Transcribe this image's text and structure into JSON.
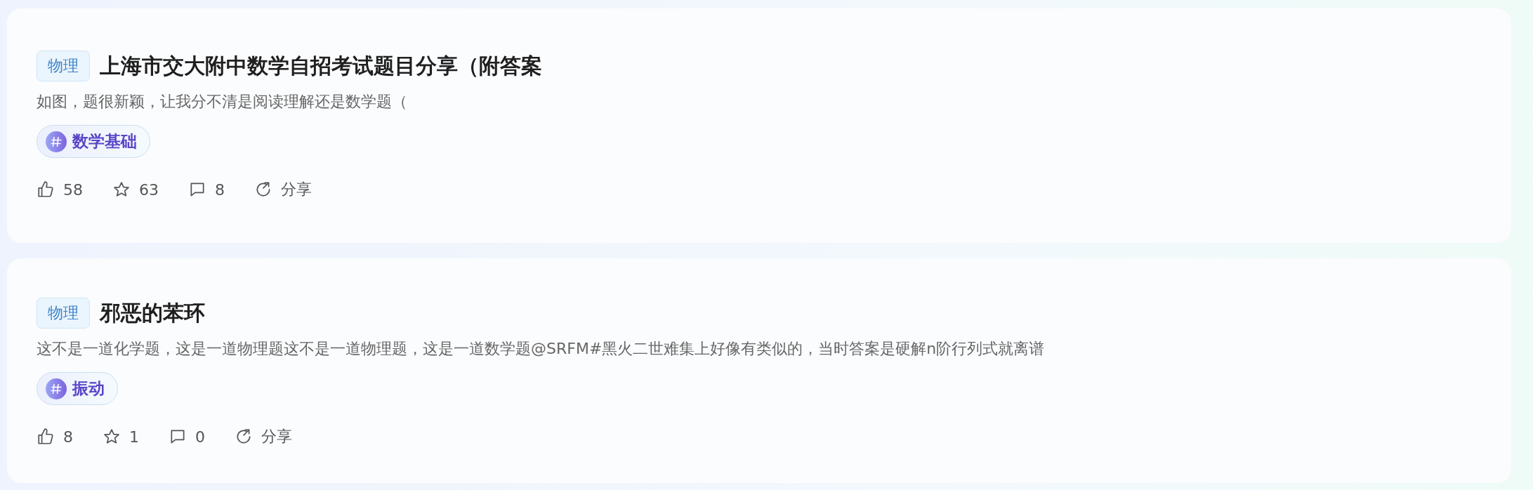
{
  "posts": [
    {
      "category": "物理",
      "title": "上海市交大附中数学自招考试题目分享（附答案",
      "excerpt": "如图，题很新颖，让我分不清是阅读理解还是数学题（",
      "tags": [
        "数学基础"
      ],
      "likes": "58",
      "favorites": "63",
      "comments": "8",
      "share": "分享"
    },
    {
      "category": "物理",
      "title": "邪恶的苯环",
      "excerpt": "这不是一道化学题，这是一道物理题这不是一道物理题，这是一道数学题@SRFM#黑火二世难集上好像有类似的，当时答案是硬解n阶行列式就离谱",
      "tags": [
        "振动"
      ],
      "likes": "8",
      "favorites": "1",
      "comments": "0",
      "share": "分享"
    }
  ]
}
